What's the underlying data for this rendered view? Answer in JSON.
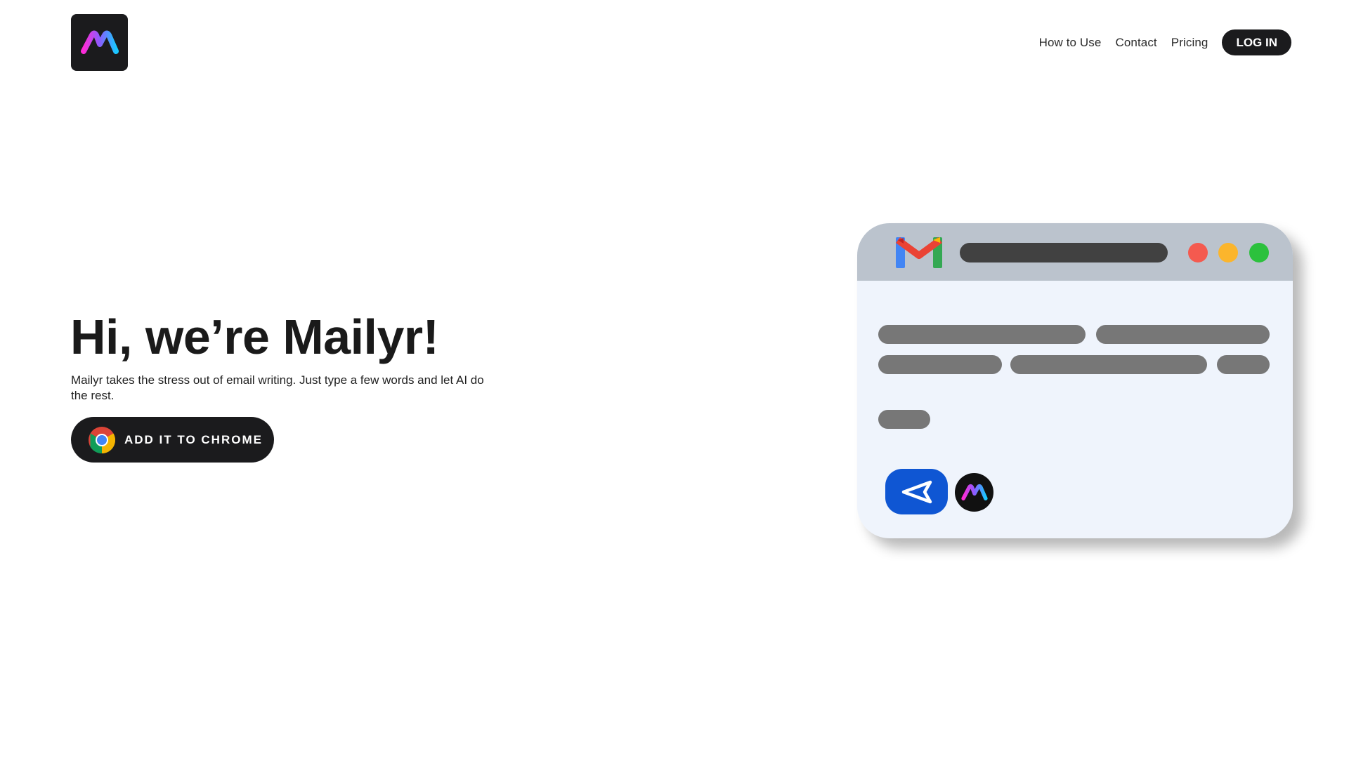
{
  "brand": {
    "name": "Mailyr",
    "logo_icon": "mailyr-m-logo-icon",
    "logo_bg": "#1b1b1d"
  },
  "nav": {
    "items": [
      {
        "label": "How to Use"
      },
      {
        "label": "Contact"
      },
      {
        "label": "Pricing"
      }
    ],
    "login_label": "LOG IN"
  },
  "hero": {
    "title": "Hi, we’re Mailyr!",
    "subtitle": "Mailyr takes the stress out of email writing. Just type a few words and let AI do the rest.",
    "cta_label": "ADD IT TO CHROME",
    "cta_icon": "chrome-icon"
  },
  "illustration": {
    "app_icon": "gmail-icon",
    "window_dots": [
      "#f45a4f",
      "#fbb52c",
      "#2cc13d"
    ],
    "send_icon": "send-icon",
    "send_color": "#0f56d3",
    "assistant_icon": "mailyr-m-logo-icon"
  }
}
